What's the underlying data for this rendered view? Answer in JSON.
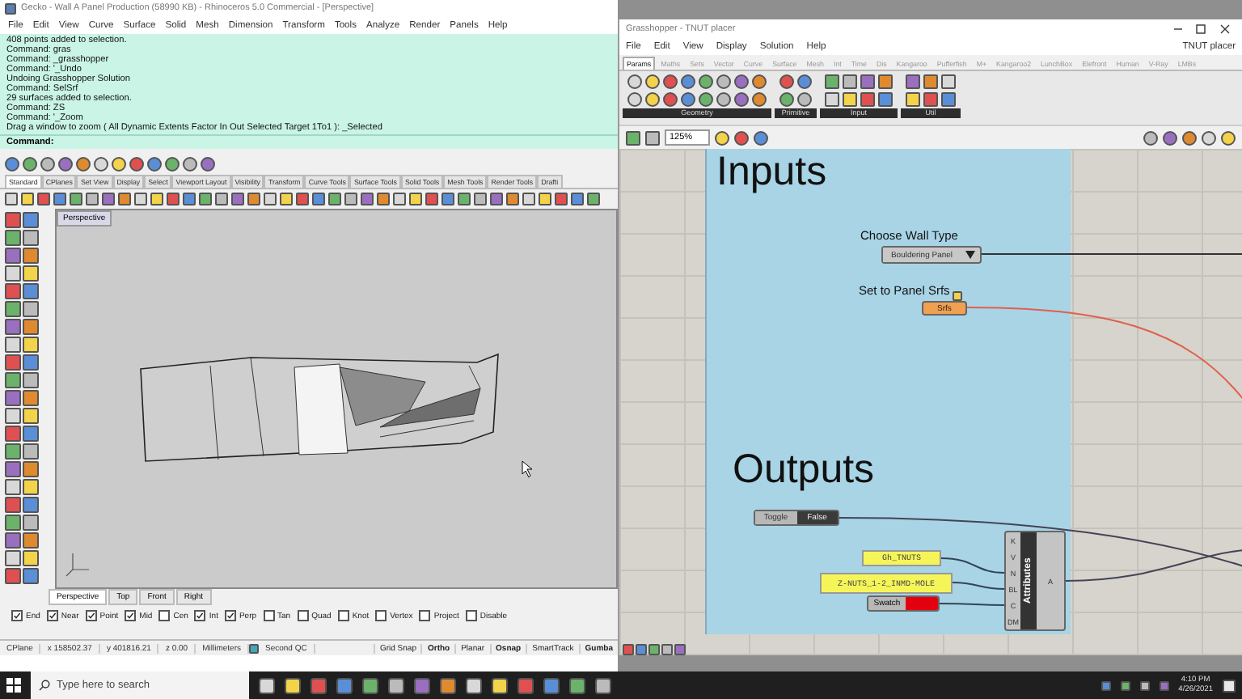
{
  "rhino": {
    "title": "Gecko - Wall A Panel Production (58990 KB) - Rhinoceros 5.0 Commercial - [Perspective]",
    "menu": [
      "File",
      "Edit",
      "View",
      "Curve",
      "Surface",
      "Solid",
      "Mesh",
      "Dimension",
      "Transform",
      "Tools",
      "Analyze",
      "Render",
      "Panels",
      "Help"
    ],
    "command_history": [
      "408 points added to selection.",
      "Command: gras",
      "Command: _grasshopper",
      "Command: '_Undo",
      "Undoing Grasshopper Solution",
      "Command: SelSrf",
      "29 surfaces added to selection.",
      "Command: ZS",
      "Command: '_Zoom",
      "Drag a window to zoom ( All  Dynamic  Extents  Factor  In  Out  Selected  Target  1To1 ): _Selected"
    ],
    "command_prompt": "Command:",
    "toolbar_tabs": [
      {
        "label": "Standard",
        "selected": true
      },
      {
        "label": "CPlanes",
        "selected": false
      },
      {
        "label": "Set View",
        "selected": false
      },
      {
        "label": "Display",
        "selected": false
      },
      {
        "label": "Select",
        "selected": false
      },
      {
        "label": "Viewport Layout",
        "selected": false
      },
      {
        "label": "Visibility",
        "selected": false
      },
      {
        "label": "Transform",
        "selected": false
      },
      {
        "label": "Curve Tools",
        "selected": false
      },
      {
        "label": "Surface Tools",
        "selected": false
      },
      {
        "label": "Solid Tools",
        "selected": false
      },
      {
        "label": "Mesh Tools",
        "selected": false
      },
      {
        "label": "Render Tools",
        "selected": false
      },
      {
        "label": "Drafti",
        "selected": false
      }
    ],
    "viewport_label": "Perspective",
    "viewport_tabs": [
      {
        "label": "Perspective",
        "selected": true
      },
      {
        "label": "Top",
        "selected": false
      },
      {
        "label": "Front",
        "selected": false
      },
      {
        "label": "Right",
        "selected": false
      }
    ],
    "osnaps": [
      {
        "label": "End",
        "checked": true
      },
      {
        "label": "Near",
        "checked": true
      },
      {
        "label": "Point",
        "checked": true
      },
      {
        "label": "Mid",
        "checked": true
      },
      {
        "label": "Cen",
        "checked": false
      },
      {
        "label": "Int",
        "checked": true
      },
      {
        "label": "Perp",
        "checked": true
      },
      {
        "label": "Tan",
        "checked": false
      },
      {
        "label": "Quad",
        "checked": false
      },
      {
        "label": "Knot",
        "checked": false
      },
      {
        "label": "Vertex",
        "checked": false
      },
      {
        "label": "Project",
        "checked": false
      },
      {
        "label": "Disable",
        "checked": false
      }
    ],
    "status_fields": [
      "CPlane",
      "x 158502.37",
      "y 401816.21",
      "z 0.00",
      "Millimeters"
    ],
    "layer": "Second QC",
    "status_toggles": [
      {
        "label": "Grid Snap",
        "on": false
      },
      {
        "label": "Ortho",
        "on": true
      },
      {
        "label": "Planar",
        "on": false
      },
      {
        "label": "Osnap",
        "on": true
      },
      {
        "label": "SmartTrack",
        "on": false
      },
      {
        "label": "Gumba",
        "on": true
      }
    ]
  },
  "grasshopper": {
    "title": "Grasshopper - TNUT placer",
    "menu": [
      "File",
      "Edit",
      "View",
      "Display",
      "Solution",
      "Help"
    ],
    "document": "TNUT placer",
    "tabs": [
      {
        "label": "Params",
        "selected": true
      },
      {
        "label": "Maths",
        "selected": false
      },
      {
        "label": "Sets",
        "selected": false
      },
      {
        "label": "Vector",
        "selected": false
      },
      {
        "label": "Curve",
        "selected": false
      },
      {
        "label": "Surface",
        "selected": false
      },
      {
        "label": "Mesh",
        "selected": false
      },
      {
        "label": "Int",
        "selected": false
      },
      {
        "label": "Time",
        "selected": false
      },
      {
        "label": "Dis",
        "selected": false
      },
      {
        "label": "Kangaroo",
        "selected": false
      },
      {
        "label": "Pufferfish",
        "selected": false
      },
      {
        "label": "M+",
        "selected": false
      },
      {
        "label": "Kangaroo2",
        "selected": false
      },
      {
        "label": "LunchBox",
        "selected": false
      },
      {
        "label": "Elefront",
        "selected": false
      },
      {
        "label": "Human",
        "selected": false
      },
      {
        "label": "V-Ray",
        "selected": false
      },
      {
        "label": "LMBs",
        "selected": false
      }
    ],
    "palette_groups": [
      "Geometry",
      "Primitive",
      "Input",
      "Util"
    ],
    "zoom": "125%",
    "canvas": {
      "inputs_title": "Inputs",
      "wall_type_label": "Choose Wall Type",
      "wall_type_value": "Bouldering Panel",
      "panel_srfs_label": "Set to Panel Srfs",
      "srfs_component": "Srfs",
      "outputs_title": "Outputs",
      "toggle": {
        "name": "Toggle",
        "value": "False"
      },
      "panels": [
        "Gh_TNUTS",
        "Z-NUTS_1-2_INMD-MOLE"
      ],
      "swatch": {
        "name": "Swatch",
        "color": "#e3000f"
      },
      "attributes": {
        "name": "Attributes",
        "inputs": [
          "K",
          "V",
          "N",
          "BL",
          "C",
          "DM"
        ],
        "output": "A"
      }
    }
  },
  "taskbar": {
    "search_placeholder": "Type here to search",
    "time": "4:10 PM",
    "date": "4/26/2021"
  }
}
